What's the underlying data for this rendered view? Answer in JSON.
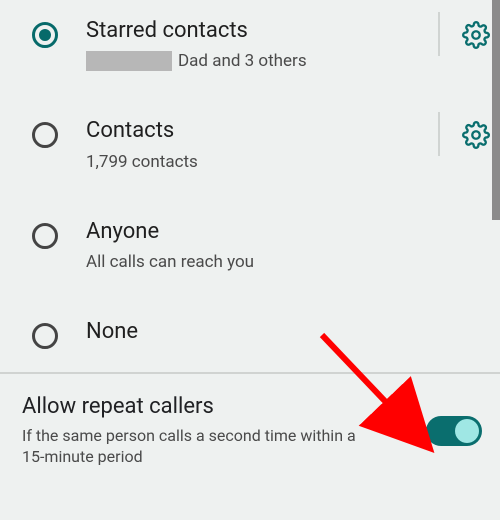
{
  "options": {
    "starred": {
      "title": "Starred contacts",
      "subtitle_suffix": "Dad and 3 others",
      "selected": true,
      "has_settings": true
    },
    "contacts": {
      "title": "Contacts",
      "subtitle": "1,799 contacts",
      "selected": false,
      "has_settings": true
    },
    "anyone": {
      "title": "Anyone",
      "subtitle": "All calls can reach you",
      "selected": false,
      "has_settings": false
    },
    "none": {
      "title": "None",
      "selected": false,
      "has_settings": false
    }
  },
  "repeat_section": {
    "title": "Allow repeat callers",
    "description": "If the same person calls a second time within a 15-minute period",
    "enabled": true
  },
  "colors": {
    "accent": "#0a6e6e"
  }
}
